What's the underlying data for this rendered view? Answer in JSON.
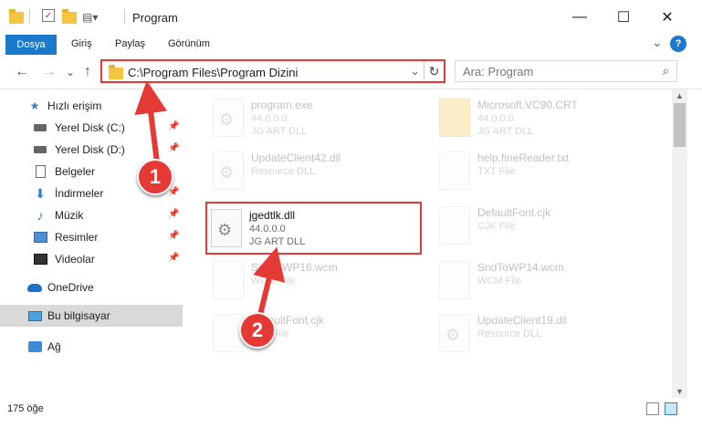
{
  "window": {
    "title": "Program",
    "minimize": "—",
    "maximize": "☐",
    "close": "✕"
  },
  "ribbon": {
    "file_tab": "Dosya",
    "tabs": [
      "Giriş",
      "Paylaş",
      "Görünüm"
    ],
    "collapse": "⌄",
    "help": "?"
  },
  "navigation": {
    "back": "←",
    "forward": "→",
    "recent": "⌄",
    "up": "↑",
    "address_path": "C:\\Program Files\\Program Dizini",
    "address_dropdown": "⌄",
    "refresh": "↻",
    "search_placeholder": "Ara: Program",
    "search_icon": "magnifier-icon"
  },
  "sidebar": {
    "quick_access": "Hızlı erişim",
    "items": [
      {
        "label": "Yerel Disk (C:)",
        "icon": "drive-icon"
      },
      {
        "label": "Yerel Disk (D:)",
        "icon": "drive-icon"
      },
      {
        "label": "Belgeler",
        "icon": "documents-icon"
      },
      {
        "label": "İndirmeler",
        "icon": "download-icon"
      },
      {
        "label": "Müzik",
        "icon": "music-icon"
      },
      {
        "label": "Resimler",
        "icon": "pictures-icon"
      },
      {
        "label": "Videolar",
        "icon": "videos-icon"
      }
    ],
    "onedrive": "OneDrive",
    "this_pc": "Bu bilgisayar",
    "network": "Ağ"
  },
  "files": [
    {
      "name": "program.exe",
      "l2": "44.0.0.0",
      "l3": "JG ART DLL"
    },
    {
      "name": "Microsoft.VC90.CRT",
      "l2": "44.0.0.0",
      "l3": "JG ART DLL"
    },
    {
      "name": "UpdateClient42.dll",
      "l2": "Resource DLL",
      "l3": ""
    },
    {
      "name": "help.fineReader.txt",
      "l2": "TXT File",
      "l3": ""
    },
    {
      "name": "jgedtlk.dll",
      "l2": "44.0.0.0",
      "l3": "JG ART DLL"
    },
    {
      "name": "DefaultFont.cjk",
      "l2": "CJK File",
      "l3": ""
    },
    {
      "name": "SndToWP16.wcm",
      "l2": "WCM File",
      "l3": ""
    },
    {
      "name": "SndToWP14.wcm",
      "l2": "WCM File",
      "l3": ""
    },
    {
      "name": "DefaultFont.cjk",
      "l2": "CJK File",
      "l3": ""
    },
    {
      "name": "UpdateClient19.dll",
      "l2": "Resource DLL",
      "l3": ""
    }
  ],
  "status": {
    "count": "175 öğe"
  },
  "callouts": {
    "one": "1",
    "two": "2"
  },
  "colors": {
    "accent": "#1979ca",
    "highlight": "#e53935"
  }
}
